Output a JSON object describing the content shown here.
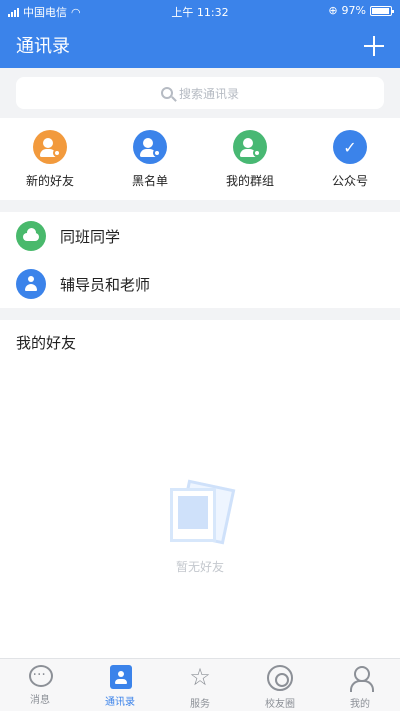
{
  "status_bar": {
    "carrier": "中国电信",
    "time": "上午 11:32",
    "battery": "97%"
  },
  "header": {
    "title": "通讯录"
  },
  "search": {
    "placeholder": "搜索通讯录"
  },
  "quick_actions": [
    {
      "label": "新的好友",
      "icon": "new-friend-icon",
      "color": "#f29a3d"
    },
    {
      "label": "黑名单",
      "icon": "blacklist-icon",
      "color": "#3b83ea"
    },
    {
      "label": "我的群组",
      "icon": "my-group-icon",
      "color": "#48b873"
    },
    {
      "label": "公众号",
      "icon": "official-account-icon",
      "color": "#3b83ea"
    }
  ],
  "groups": [
    {
      "label": "同班同学",
      "icon": "classmates-icon",
      "color": "#49b96c"
    },
    {
      "label": "辅导员和老师",
      "icon": "teachers-icon",
      "color": "#3b83ea"
    }
  ],
  "friends": {
    "title": "我的好友",
    "empty_text": "暂无好友"
  },
  "tabs": [
    {
      "label": "消息",
      "icon": "message-icon",
      "active": false
    },
    {
      "label": "通讯录",
      "icon": "contacts-icon",
      "active": true
    },
    {
      "label": "服务",
      "icon": "service-icon",
      "active": false
    },
    {
      "label": "校友圈",
      "icon": "alumni-circle-icon",
      "active": false
    },
    {
      "label": "我的",
      "icon": "profile-icon",
      "active": false
    }
  ],
  "colors": {
    "primary": "#3b83ea",
    "background": "#f2f3f5"
  }
}
